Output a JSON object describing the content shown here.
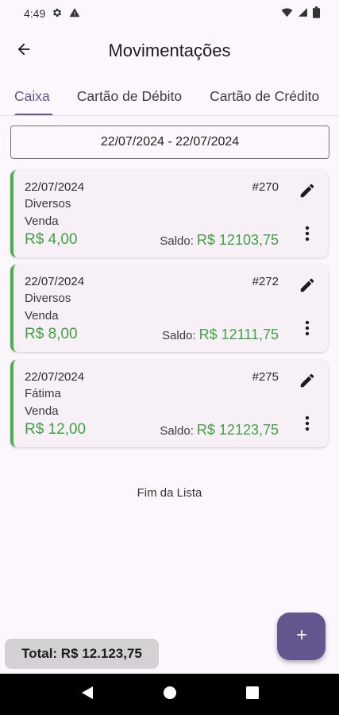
{
  "status_bar": {
    "time": "4:49"
  },
  "header": {
    "title": "Movimentações"
  },
  "tabs": [
    {
      "label": "Caixa"
    },
    {
      "label": "Cartão de Débito"
    },
    {
      "label": "Cartão de Crédito"
    }
  ],
  "date_range": "22/07/2024 - 22/07/2024",
  "transactions": [
    {
      "date": "22/07/2024",
      "id": "#270",
      "category": "Diversos",
      "type": "Venda",
      "amount": "R$ 4,00",
      "saldo_label": "Saldo:",
      "saldo_value": "R$ 12103,75"
    },
    {
      "date": "22/07/2024",
      "id": "#272",
      "category": "Diversos",
      "type": "Venda",
      "amount": "R$ 8,00",
      "saldo_label": "Saldo:",
      "saldo_value": "R$ 12111,75"
    },
    {
      "date": "22/07/2024",
      "id": "#275",
      "category": "Fátima",
      "type": "Venda",
      "amount": "R$ 12,00",
      "saldo_label": "Saldo:",
      "saldo_value": "R$ 12123,75"
    }
  ],
  "list_end": "Fim da Lista",
  "total": "Total: R$ 12.123,75",
  "colors": {
    "accent": "#65558f",
    "positive": "#43a047",
    "card_border": "#4caf50"
  },
  "icons": [
    "settings-icon",
    "warning-icon",
    "wifi-icon",
    "signal-icon",
    "battery-icon",
    "back-arrow-icon",
    "edit-pencil-icon",
    "more-vert-icon",
    "plus-icon",
    "nav-back-icon",
    "nav-home-icon",
    "nav-recents-icon"
  ]
}
